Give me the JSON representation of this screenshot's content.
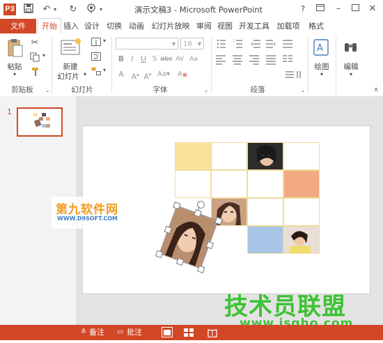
{
  "window": {
    "title": "演示文稿3 - Microsoft PowerPoint",
    "app_logo": "P3",
    "help_button": "?",
    "controls": [
      "restore",
      "minimize",
      "maximize",
      "close"
    ]
  },
  "quick_access": [
    "save-icon",
    "undo-icon",
    "redo-icon",
    "touch-mode-icon"
  ],
  "tabs": {
    "file": "文件",
    "items": [
      "开始",
      "插入",
      "设计",
      "切换",
      "动画",
      "幻灯片放映",
      "审阅",
      "视图",
      "开发工具",
      "加载项",
      "格式"
    ],
    "active": "开始"
  },
  "ribbon": {
    "clipboard": {
      "paste": "粘贴",
      "group": "剪贴板"
    },
    "slides": {
      "new_slide_1": "新建",
      "new_slide_2": "幻灯片",
      "group": "幻灯片"
    },
    "font": {
      "size": "18",
      "group": "字体"
    },
    "paragraph": {
      "group": "段落"
    },
    "drawing": {
      "label": "绘图"
    },
    "editing": {
      "label": "编辑"
    }
  },
  "thumbnails": {
    "slide_number": "1"
  },
  "statusbar": {
    "notes": "备注",
    "comments": "批注"
  },
  "watermarks": {
    "site_logo": "第九软件网",
    "site_url": "WWW.D9SOFT.COM",
    "corner_logo": "技术员联盟",
    "corner_url": "www.jsgho.com"
  },
  "colors": {
    "accent": "#d24726",
    "cell_border": "#f1dc9b",
    "fill_yellow": "#fbe29c",
    "fill_orange": "#f2aa83",
    "fill_blue": "#a8c5e7"
  }
}
